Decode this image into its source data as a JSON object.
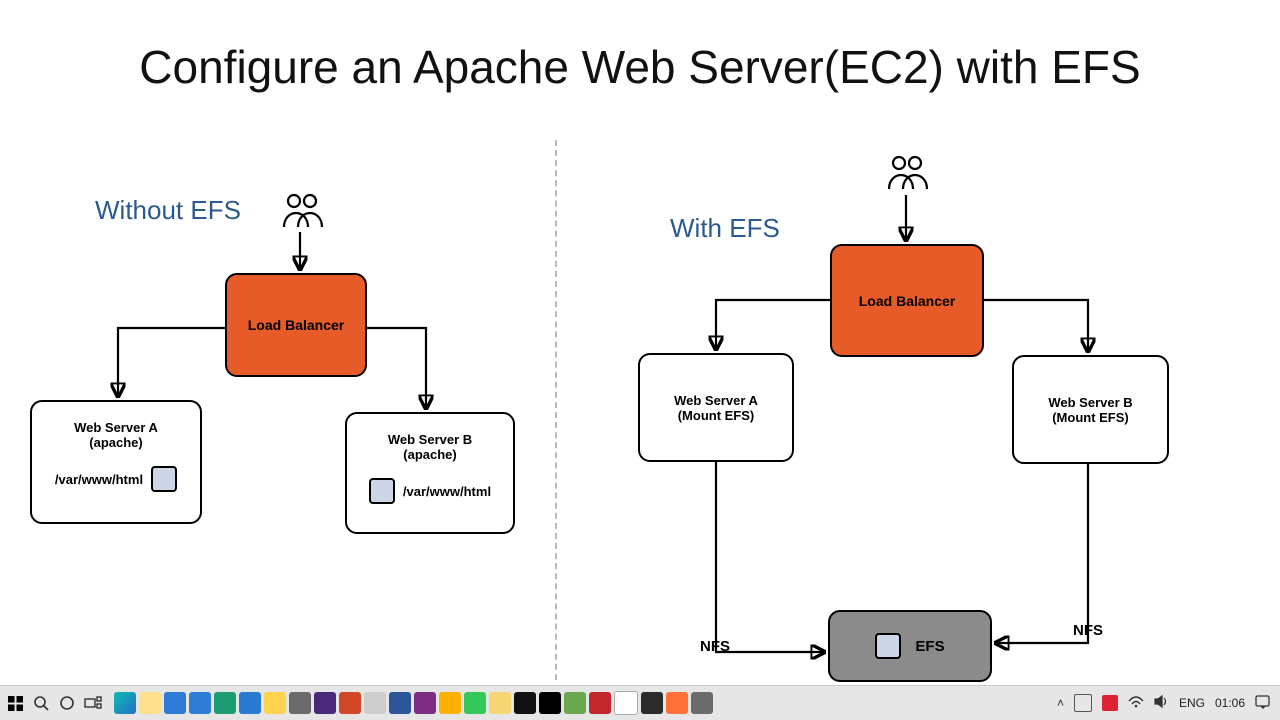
{
  "title": "Configure an Apache Web Server(EC2) with EFS",
  "left": {
    "label": "Without EFS",
    "load_balancer": "Load Balancer",
    "server_a": {
      "name": "Web Server A",
      "sub": "(apache)",
      "path": "/var/www/html"
    },
    "server_b": {
      "name": "Web Server B",
      "sub": "(apache)",
      "path": "/var/www/html"
    }
  },
  "right": {
    "label": "With EFS",
    "load_balancer": "Load Balancer",
    "server_a": {
      "name": "Web Server A",
      "sub": "(Mount EFS)"
    },
    "server_b": {
      "name": "Web Server B",
      "sub": "(Mount EFS)"
    },
    "efs": "EFS",
    "nfs_a": "NFS",
    "nfs_b": "NFS"
  },
  "taskbar": {
    "lang": "ENG",
    "time": "01:06",
    "tray_icons": [
      "up",
      "project",
      "wifi",
      "vol"
    ]
  }
}
